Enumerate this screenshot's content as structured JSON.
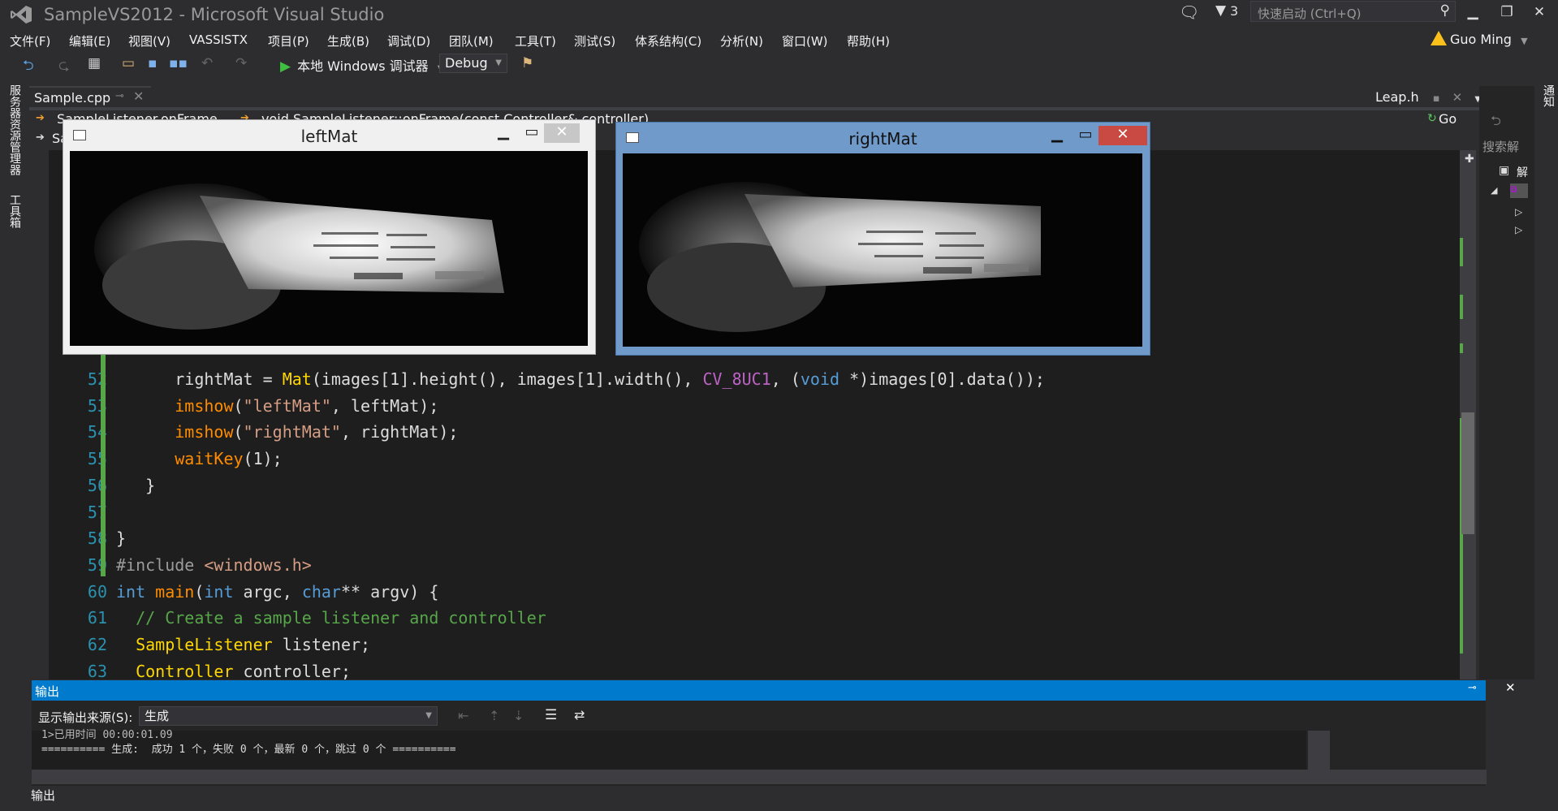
{
  "window": {
    "title": "SampleVS2012 - Microsoft Visual Studio",
    "filter_count": "3",
    "quicklaunch_placeholder": "快速启动 (Ctrl+Q)",
    "minimize": "▁",
    "restore": "❐",
    "close": "✕"
  },
  "menu": [
    "文件(F)",
    "编辑(E)",
    "视图(V)",
    "VASSISTX",
    "项目(P)",
    "生成(B)",
    "调试(D)",
    "团队(M)",
    "工具(T)",
    "测试(S)",
    "体系结构(C)",
    "分析(N)",
    "窗口(W)",
    "帮助(H)"
  ],
  "user": {
    "name": "Guo Ming"
  },
  "toolbar": {
    "run_label": "本地 Windows 调试器",
    "config": "Debug"
  },
  "left_strip": {
    "server_explorer": "服务器资源管理器",
    "toolbox": "工具箱"
  },
  "right_strip": {
    "notifications": "通知"
  },
  "tabs": {
    "active": "Sample.cpp",
    "right": "Leap.h"
  },
  "nav": {
    "scope": "SampleListener.onFrame",
    "member": "void SampleListener::onFrame(const Controller& controller)",
    "second_prefix": "Sa",
    "go": "Go"
  },
  "solution": {
    "search": "搜索解",
    "node_label": "解"
  },
  "code_lines": [
    {
      "n": "52",
      "segs": [
        [
          "tx",
          "      rightMat = "
        ],
        [
          "ty",
          "Mat"
        ],
        [
          "tx",
          "(images[1].height(), images[1].width(), "
        ],
        [
          "mac",
          "CV_8UC1"
        ],
        [
          "tx",
          ", ("
        ],
        [
          "kw",
          "void"
        ],
        [
          "tx",
          " *)images[0].data());"
        ]
      ]
    },
    {
      "n": "53",
      "segs": [
        [
          "tx",
          "      "
        ],
        [
          "fn",
          "imshow"
        ],
        [
          "tx",
          "("
        ],
        [
          "str",
          "\"leftMat\""
        ],
        [
          "tx",
          ", leftMat);"
        ]
      ]
    },
    {
      "n": "54",
      "segs": [
        [
          "tx",
          "      "
        ],
        [
          "fn",
          "imshow"
        ],
        [
          "tx",
          "("
        ],
        [
          "str",
          "\"rightMat\""
        ],
        [
          "tx",
          ", rightMat);"
        ]
      ]
    },
    {
      "n": "55",
      "segs": [
        [
          "tx",
          "      "
        ],
        [
          "fn",
          "waitKey"
        ],
        [
          "tx",
          "(1);"
        ]
      ]
    },
    {
      "n": "56",
      "segs": [
        [
          "tx",
          "   }"
        ]
      ]
    },
    {
      "n": "57",
      "segs": [
        [
          "tx",
          ""
        ]
      ]
    },
    {
      "n": "58",
      "segs": [
        [
          "tx",
          "}"
        ]
      ]
    },
    {
      "n": "59",
      "segs": [
        [
          "pp",
          "#include "
        ],
        [
          "hdr",
          "<windows.h>"
        ]
      ]
    },
    {
      "n": "60",
      "segs": [
        [
          "kw",
          "int "
        ],
        [
          "fn",
          "main"
        ],
        [
          "tx",
          "("
        ],
        [
          "kw",
          "int"
        ],
        [
          "tx",
          " argc, "
        ],
        [
          "kw",
          "char"
        ],
        [
          "tx",
          "** argv) {"
        ]
      ]
    },
    {
      "n": "61",
      "segs": [
        [
          "cm",
          "  // Create a sample listener and controller"
        ]
      ]
    },
    {
      "n": "62",
      "segs": [
        [
          "ty",
          "  SampleListener"
        ],
        [
          "tx",
          " listener;"
        ]
      ]
    },
    {
      "n": "63",
      "segs": [
        [
          "ty",
          "  Controller"
        ],
        [
          "tx",
          " controller;"
        ]
      ]
    }
  ],
  "cv_windows": {
    "left_title": "leftMat",
    "right_title": "rightMat"
  },
  "output": {
    "title": "输出",
    "source_label": "显示输出来源(S):",
    "source_value": "生成",
    "line1": "1>已用时间 00:00:01.09",
    "line2": "========== 生成:  成功 1 个，失败 0 个，最新 0 个，跳过 0 个 ==========",
    "bottom_tab": "输出"
  },
  "colors": {
    "accent": "#007acc",
    "green": "#57a64a",
    "keyword": "#569cd6",
    "function": "#ff8c00",
    "type": "#ffd700"
  }
}
